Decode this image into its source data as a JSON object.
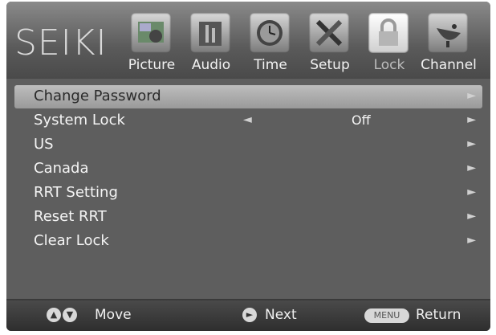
{
  "brand": "SEIKI",
  "tabs": [
    {
      "label": "Picture",
      "icon": "picture-icon"
    },
    {
      "label": "Audio",
      "icon": "audio-icon"
    },
    {
      "label": "Time",
      "icon": "clock-icon"
    },
    {
      "label": "Setup",
      "icon": "setup-tools-icon"
    },
    {
      "label": "Lock",
      "icon": "lock-icon",
      "active": true
    },
    {
      "label": "Channel",
      "icon": "satellite-dish-icon"
    }
  ],
  "menu": {
    "items": [
      {
        "label": "Change Password",
        "selected": true
      },
      {
        "label": "System Lock",
        "value": "Off"
      },
      {
        "label": "US"
      },
      {
        "label": "Canada"
      },
      {
        "label": "RRT Setting"
      },
      {
        "label": "Reset RRT"
      },
      {
        "label": "Clear Lock"
      }
    ]
  },
  "footer": {
    "move": "Move",
    "next": "Next",
    "menu_key": "MENU",
    "return": "Return"
  }
}
